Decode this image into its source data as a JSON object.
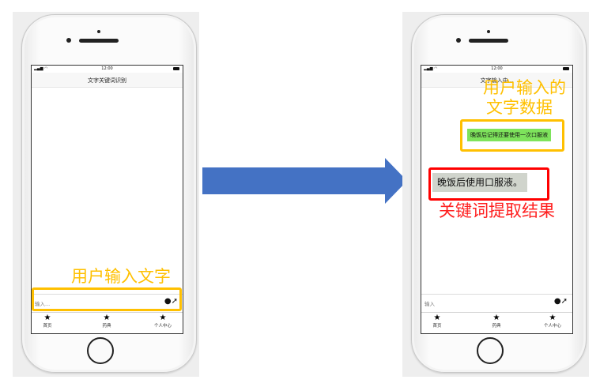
{
  "left_phone": {
    "status_time": "12:00",
    "nav_title": "文字关键词识别",
    "input_placeholder": "输入...",
    "tabs": [
      {
        "label": "首页",
        "icon": "star-icon"
      },
      {
        "label": "药典",
        "icon": "star-icon"
      },
      {
        "label": "个人中心",
        "icon": "star-icon"
      }
    ]
  },
  "right_phone": {
    "status_time": "12:00",
    "nav_title": "文字输入中...",
    "user_message": "晚饭后记得还要使用一次口服液",
    "result_message": "晚饭后使用口服液。",
    "input_placeholder": "输入",
    "tabs": [
      {
        "label": "首页",
        "icon": "star-icon"
      },
      {
        "label": "药典",
        "icon": "star-icon"
      },
      {
        "label": "个人中心",
        "icon": "star-icon"
      }
    ]
  },
  "annotations": {
    "user_input_text": "用户输入文字",
    "user_input_data_line1": "用户输入的",
    "user_input_data_line2": "文字数据",
    "keyword_result": "关键词提取结果"
  },
  "colors": {
    "arrow": "#4472c4",
    "annotation_yellow": "#ffc000",
    "annotation_red": "#ff0000",
    "user_bubble": "#7ee35c",
    "result_bubble": "#d0d4cc"
  }
}
